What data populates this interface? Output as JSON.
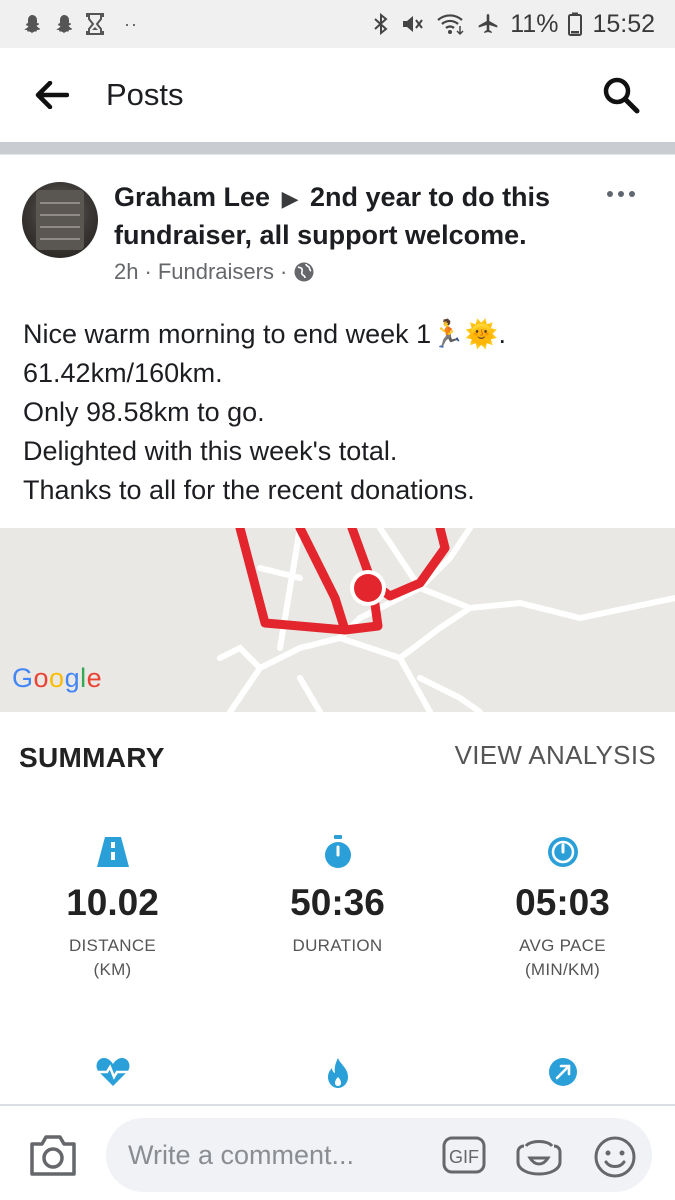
{
  "status_bar": {
    "battery": "11%",
    "time": "15:52",
    "left_icons": [
      "snapchat-icon",
      "snapchat-icon",
      "hourglass-icon"
    ],
    "right_icons": [
      "bluetooth-icon",
      "vibrate-mute-icon",
      "wifi-icon",
      "airplane-icon",
      "battery-icon"
    ]
  },
  "header": {
    "title": "Posts",
    "back_icon": "arrow-left-icon",
    "search_icon": "search-icon"
  },
  "post": {
    "author": "Graham Lee",
    "arrow": "▶",
    "headline": "2nd year to do this fundraiser, all support welcome.",
    "time": "2h",
    "group": "Fundraisers",
    "audience_icon": "globe-icon",
    "body_lines": [
      "Nice warm morning to end week 1",
      "61.42km/160km.",
      "Only 98.58km to go.",
      "Delighted with this week's total.",
      "Thanks to all for the recent donations."
    ],
    "body_emoji": "🏃🌞",
    "body_emoji_suffix": "."
  },
  "map": {
    "attribution": "Google",
    "route_color": "#e3262e"
  },
  "summary": {
    "title": "SUMMARY",
    "view_analysis": "VIEW ANALYSIS",
    "accent_color": "#2b9fd8",
    "stats": [
      {
        "icon": "road-icon",
        "value": "10.02",
        "label": "DISTANCE",
        "unit": "(KM)"
      },
      {
        "icon": "stopwatch-icon",
        "value": "50:36",
        "label": "DURATION",
        "unit": ""
      },
      {
        "icon": "speedometer-icon",
        "value": "05:03",
        "label": "AVG PACE",
        "unit": "(MIN/KM)"
      }
    ],
    "second_row_icons": [
      "heart-rate-icon",
      "flame-icon",
      "elevation-arrow-icon"
    ]
  },
  "comment_bar": {
    "placeholder": "Write a comment...",
    "gif_label": "GIF",
    "icons": [
      "camera-icon",
      "gif-icon",
      "sticker-icon",
      "emoji-icon"
    ]
  }
}
